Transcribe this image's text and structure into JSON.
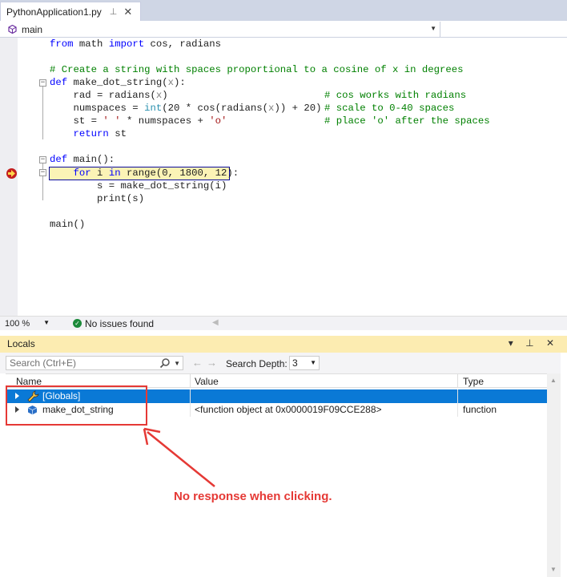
{
  "tab": {
    "title": "PythonApplication1.py",
    "pin": "⊥",
    "close": "✕"
  },
  "nav": {
    "scope": "main"
  },
  "code": {
    "l1": [
      [
        "kw",
        "from"
      ],
      [
        "",
        "&nbsp;math&nbsp;"
      ],
      [
        "kw",
        "import"
      ],
      [
        "",
        "&nbsp;cos,&nbsp;radians"
      ]
    ],
    "comment1": "# Create a string with spaces proportional to a cosine of x in degrees",
    "def1": "def",
    "def1_rest": " make_dot_string(",
    "def1_param": "x",
    "def1_end": "):",
    "rad_a": "    rad = radians(",
    "rad_b": "x",
    "rad_c": ")",
    "rad_cm": "# cos works with radians",
    "ns_a": "    numspaces = ",
    "ns_int": "int",
    "ns_b": "(20 * cos(radians(",
    "ns_c": "x",
    "ns_d": ")) + 20)",
    "ns_cm": "# scale to 0-40 spaces",
    "st_a": "    st = ",
    "st_s1": "' '",
    "st_b": " * numspaces + ",
    "st_s2": "'o'",
    "st_cm": "# place 'o' after the spaces",
    "ret_kw": "return",
    "ret_rest": " st",
    "def2": "def",
    "def2_rest": " main():",
    "for_a": "for",
    "for_b": " i ",
    "for_c": "in",
    "for_d": " range(0, 1800, 12):",
    "s_line": "        s = make_dot_string(i)",
    "print_line": "        print(s)",
    "main_call": "main()"
  },
  "status": {
    "zoom": "100 %",
    "issues": "No issues found"
  },
  "locals": {
    "title": "Locals",
    "controls": "▾ ⊥ ✕",
    "search_placeholder": "Search (Ctrl+E)",
    "depth_label": "Search Depth:",
    "depth_value": "3",
    "columns": {
      "name": "Name",
      "value": "Value",
      "type": "Type"
    },
    "rows": [
      {
        "name": "[Globals]",
        "value": "",
        "type": ""
      },
      {
        "name": "make_dot_string",
        "value": "<function object at 0x0000019F09CCE288>",
        "type": "function"
      }
    ]
  },
  "annotation": "No response when clicking.",
  "colors": {
    "annotation": "#e53935",
    "selection": "#0a79d6",
    "current_line": "#fbf3b6"
  }
}
